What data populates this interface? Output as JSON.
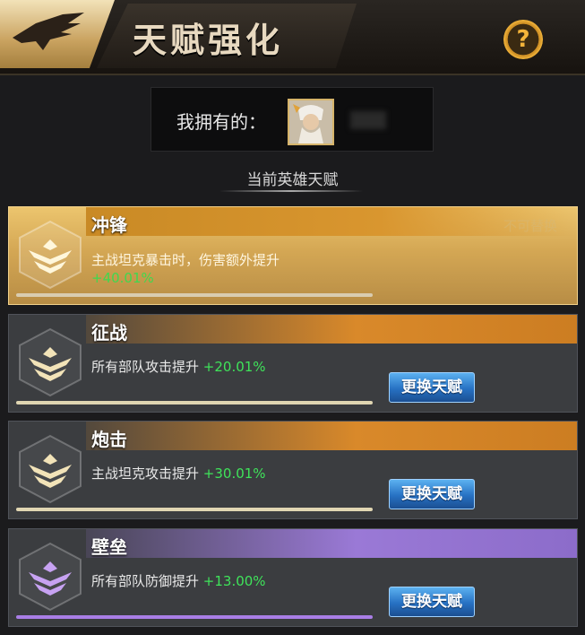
{
  "header": {
    "title": "天赋强化"
  },
  "owned": {
    "label": "我拥有的："
  },
  "section": {
    "subtitle": "当前英雄天赋"
  },
  "colors": {
    "gold": "#d4a754",
    "orange_band": "#d9892a",
    "purple_band": "#9a79d6",
    "green_bonus": "#3fe35a",
    "button_blue": "#2771c3"
  },
  "talents": [
    {
      "name": "冲锋",
      "description": "主战坦克暴击时，伤害额外提升",
      "bonus": "+40.01%",
      "status": "不可替换",
      "active": true
    },
    {
      "name": "征战",
      "description": "所有部队攻击提升",
      "bonus": "+20.01%",
      "button": "更换天赋"
    },
    {
      "name": "炮击",
      "description": "主战坦克攻击提升",
      "bonus": "+30.01%",
      "button": "更换天赋"
    },
    {
      "name": "壁垒",
      "description": "所有部队防御提升",
      "bonus": "+13.00%",
      "button": "更换天赋"
    }
  ],
  "icons": {
    "back": "eagle-back-icon",
    "help": "question-icon",
    "talent": "rank-chevron-icon"
  }
}
